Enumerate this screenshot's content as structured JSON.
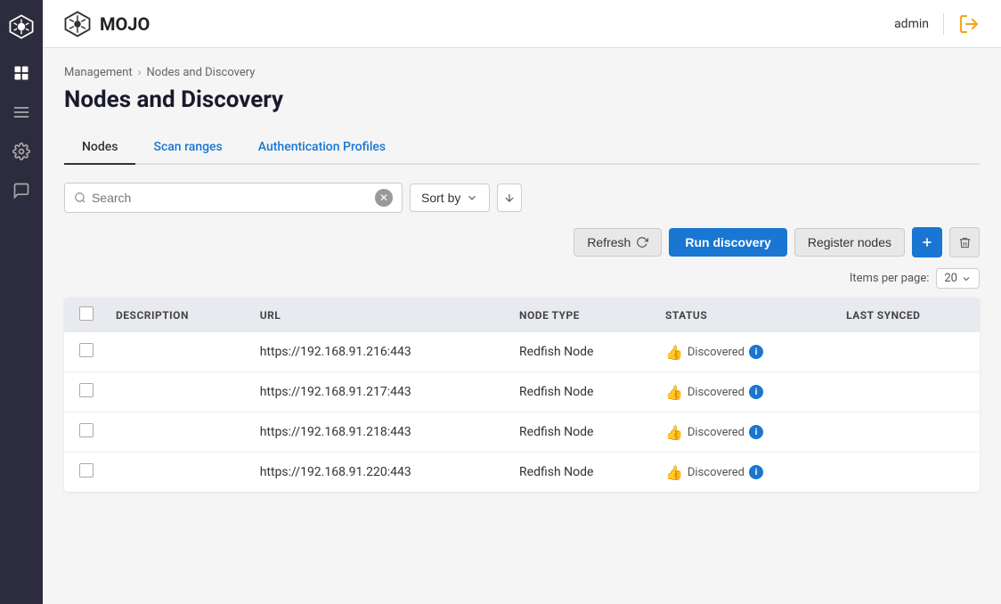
{
  "brand": {
    "name": "MOJO"
  },
  "topbar": {
    "user": "admin",
    "logout_icon": "→"
  },
  "breadcrumb": {
    "parent": "Management",
    "current": "Nodes and Discovery",
    "separator": "›"
  },
  "page_title": "Nodes and Discovery",
  "tabs": [
    {
      "id": "nodes",
      "label": "Nodes",
      "active": true
    },
    {
      "id": "scan-ranges",
      "label": "Scan ranges",
      "active": false
    },
    {
      "id": "auth-profiles",
      "label": "Authentication Profiles",
      "active": false
    }
  ],
  "toolbar": {
    "search_placeholder": "Search",
    "sort_label": "Sort by",
    "refresh_label": "Refresh",
    "run_discovery_label": "Run discovery",
    "register_nodes_label": "Register nodes",
    "items_per_page_label": "Items per page:",
    "items_per_page_value": "20"
  },
  "table": {
    "columns": [
      {
        "id": "select",
        "label": ""
      },
      {
        "id": "description",
        "label": "DESCRIPTION"
      },
      {
        "id": "url",
        "label": "URL"
      },
      {
        "id": "node_type",
        "label": "NODE TYPE"
      },
      {
        "id": "status",
        "label": "STATUS"
      },
      {
        "id": "last_synced",
        "label": "LAST SYNCED"
      }
    ],
    "rows": [
      {
        "description": "",
        "url": "https://192.168.91.216:443",
        "node_type": "Redfish Node",
        "status": "Discovered",
        "last_synced": ""
      },
      {
        "description": "",
        "url": "https://192.168.91.217:443",
        "node_type": "Redfish Node",
        "status": "Discovered",
        "last_synced": ""
      },
      {
        "description": "",
        "url": "https://192.168.91.218:443",
        "node_type": "Redfish Node",
        "status": "Discovered",
        "last_synced": ""
      },
      {
        "description": "",
        "url": "https://192.168.91.220:443",
        "node_type": "Redfish Node",
        "status": "Discovered",
        "last_synced": ""
      }
    ]
  }
}
